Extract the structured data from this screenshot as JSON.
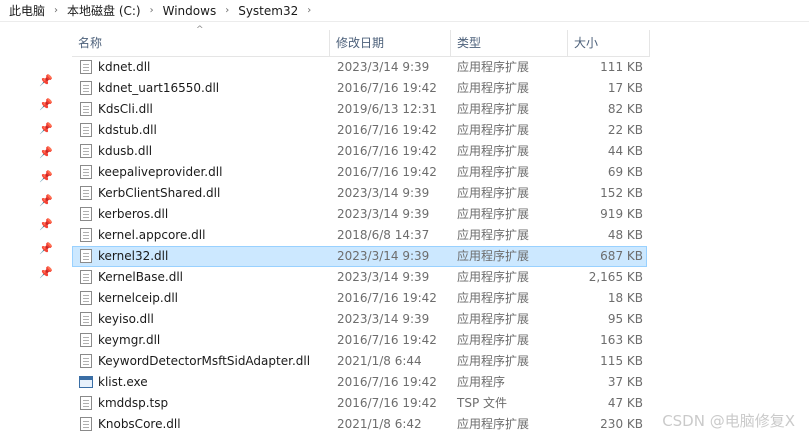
{
  "breadcrumb": [
    "此电脑",
    "本地磁盘 (C:)",
    "Windows",
    "System32"
  ],
  "columns": {
    "name": "名称",
    "date": "修改日期",
    "type": "类型",
    "size": "大小"
  },
  "rows": [
    {
      "name": "kdnet.dll",
      "date": "2023/3/14 9:39",
      "type": "应用程序扩展",
      "size": "111 KB",
      "icon": "dll-file-icon"
    },
    {
      "name": "kdnet_uart16550.dll",
      "date": "2016/7/16 19:42",
      "type": "应用程序扩展",
      "size": "17 KB",
      "icon": "dll-file-icon"
    },
    {
      "name": "KdsCli.dll",
      "date": "2019/6/13 12:31",
      "type": "应用程序扩展",
      "size": "82 KB",
      "icon": "dll-file-icon"
    },
    {
      "name": "kdstub.dll",
      "date": "2016/7/16 19:42",
      "type": "应用程序扩展",
      "size": "22 KB",
      "icon": "dll-file-icon"
    },
    {
      "name": "kdusb.dll",
      "date": "2016/7/16 19:42",
      "type": "应用程序扩展",
      "size": "44 KB",
      "icon": "dll-file-icon"
    },
    {
      "name": "keepaliveprovider.dll",
      "date": "2016/7/16 19:42",
      "type": "应用程序扩展",
      "size": "69 KB",
      "icon": "dll-file-icon"
    },
    {
      "name": "KerbClientShared.dll",
      "date": "2023/3/14 9:39",
      "type": "应用程序扩展",
      "size": "152 KB",
      "icon": "dll-file-icon"
    },
    {
      "name": "kerberos.dll",
      "date": "2023/3/14 9:39",
      "type": "应用程序扩展",
      "size": "919 KB",
      "icon": "dll-file-icon"
    },
    {
      "name": "kernel.appcore.dll",
      "date": "2018/6/8 14:37",
      "type": "应用程序扩展",
      "size": "48 KB",
      "icon": "dll-file-icon"
    },
    {
      "name": "kernel32.dll",
      "date": "2023/3/14 9:39",
      "type": "应用程序扩展",
      "size": "687 KB",
      "icon": "dll-file-icon",
      "selected": true
    },
    {
      "name": "KernelBase.dll",
      "date": "2023/3/14 9:39",
      "type": "应用程序扩展",
      "size": "2,165 KB",
      "icon": "dll-file-icon"
    },
    {
      "name": "kernelceip.dll",
      "date": "2016/7/16 19:42",
      "type": "应用程序扩展",
      "size": "18 KB",
      "icon": "dll-file-icon"
    },
    {
      "name": "keyiso.dll",
      "date": "2023/3/14 9:39",
      "type": "应用程序扩展",
      "size": "95 KB",
      "icon": "dll-file-icon"
    },
    {
      "name": "keymgr.dll",
      "date": "2016/7/16 19:42",
      "type": "应用程序扩展",
      "size": "163 KB",
      "icon": "dll-file-icon"
    },
    {
      "name": "KeywordDetectorMsftSidAdapter.dll",
      "date": "2021/1/8 6:44",
      "type": "应用程序扩展",
      "size": "115 KB",
      "icon": "dll-file-icon"
    },
    {
      "name": "klist.exe",
      "date": "2016/7/16 19:42",
      "type": "应用程序",
      "size": "37 KB",
      "icon": "exe-file-icon"
    },
    {
      "name": "kmddsp.tsp",
      "date": "2016/7/16 19:42",
      "type": "TSP 文件",
      "size": "47 KB",
      "icon": "tsp-file-icon"
    },
    {
      "name": "KnobsCore.dll",
      "date": "2021/1/8 6:42",
      "type": "应用程序扩展",
      "size": "230 KB",
      "icon": "dll-file-icon"
    }
  ],
  "watermark": "CSDN @电脑修复X",
  "colors": {
    "selection_bg": "#cce8ff",
    "selection_border": "#99d1ff",
    "header_text": "#4c607a",
    "pin": "#5a7fb0"
  }
}
